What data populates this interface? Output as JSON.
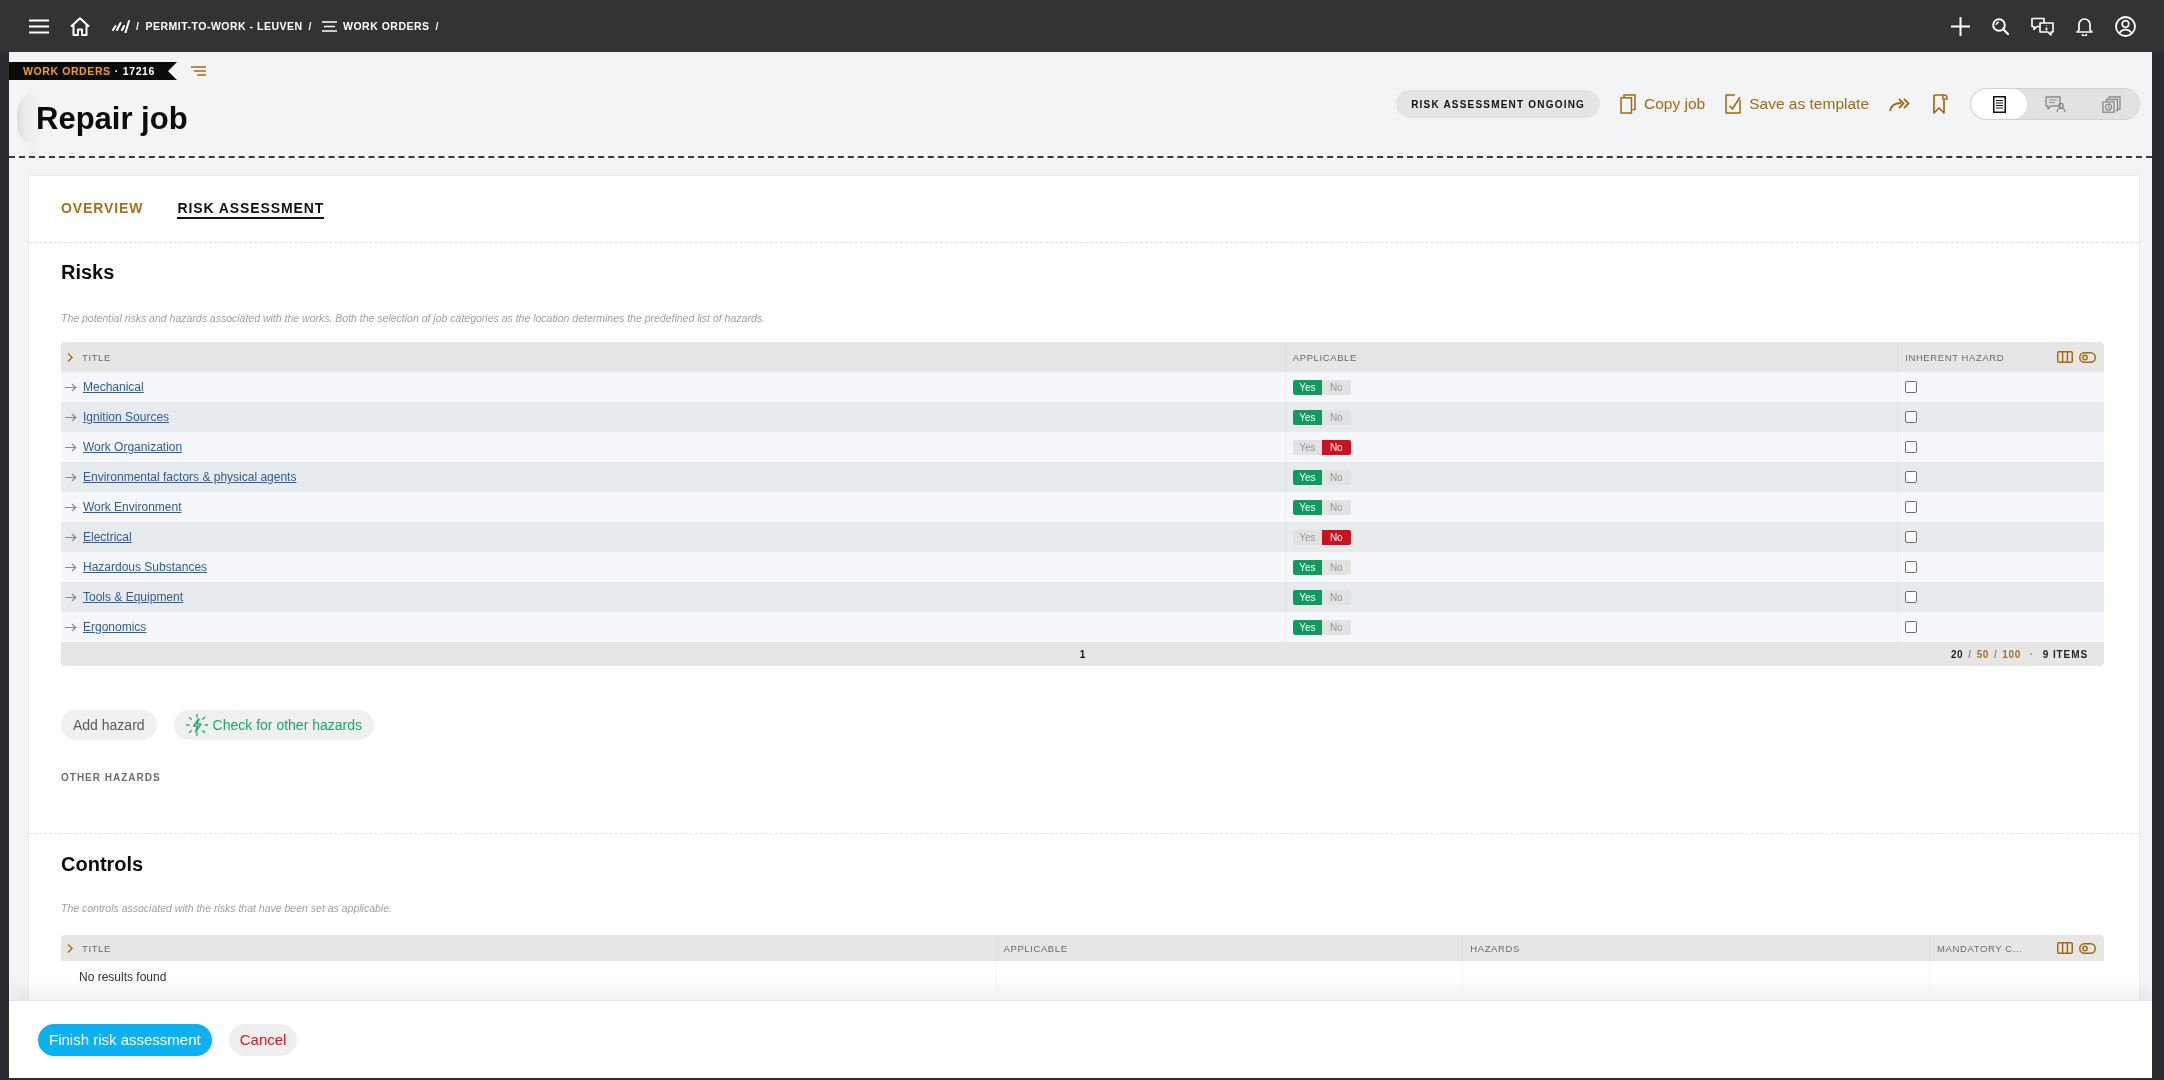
{
  "top_bar": {
    "breadcrumbs": {
      "leading_separator": "/",
      "items": [
        {
          "kind": "site",
          "label": "PERMIT-TO-WORK - LEUVEN",
          "separator": "/"
        },
        {
          "kind": "list",
          "label": "WORK ORDERS",
          "separator": "/"
        }
      ]
    }
  },
  "header": {
    "record_ribbon": {
      "module": "WORK ORDERS",
      "separator": "·",
      "number": "17216"
    },
    "title": "Repair job",
    "status": "RISK ASSESSMENT ONGOING",
    "actions": [
      {
        "kind": "copy",
        "label": "Copy job"
      },
      {
        "kind": "template",
        "label": "Save as template"
      }
    ],
    "view_switch": [
      {
        "kind": "details",
        "selected": true
      },
      {
        "kind": "comments",
        "selected": false
      },
      {
        "kind": "history",
        "selected": false
      }
    ]
  },
  "tabs": [
    {
      "label": "OVERVIEW",
      "selected": false
    },
    {
      "label": "RISK ASSESSMENT",
      "selected": true
    }
  ],
  "risks": {
    "title": "Risks",
    "description": "The potential risks and hazards associated with the works. Both the selection of job categories as the location determines the predefined list of hazards.",
    "table": {
      "columns": [
        "TITLE",
        "APPLICABLE",
        "INHERENT HAZARD"
      ],
      "rows": [
        {
          "title": "Mechanical",
          "applicable": [
            {
              "kind": "yes",
              "label": "Yes",
              "selected": true
            },
            {
              "kind": "no",
              "label": "No",
              "selected": false
            }
          ],
          "inherent_hazard_checked": false
        },
        {
          "title": "Ignition Sources",
          "applicable": [
            {
              "kind": "yes",
              "label": "Yes",
              "selected": true
            },
            {
              "kind": "no",
              "label": "No",
              "selected": false
            }
          ],
          "inherent_hazard_checked": false
        },
        {
          "title": "Work Organization",
          "applicable": [
            {
              "kind": "yes",
              "label": "Yes",
              "selected": false
            },
            {
              "kind": "no",
              "label": "No",
              "selected": true
            }
          ],
          "inherent_hazard_checked": false
        },
        {
          "title": "Environmental factors & physical agents",
          "applicable": [
            {
              "kind": "yes",
              "label": "Yes",
              "selected": true
            },
            {
              "kind": "no",
              "label": "No",
              "selected": false
            }
          ],
          "inherent_hazard_checked": false
        },
        {
          "title": "Work Environment",
          "applicable": [
            {
              "kind": "yes",
              "label": "Yes",
              "selected": true
            },
            {
              "kind": "no",
              "label": "No",
              "selected": false
            }
          ],
          "inherent_hazard_checked": false
        },
        {
          "title": "Electrical",
          "applicable": [
            {
              "kind": "yes",
              "label": "Yes",
              "selected": false
            },
            {
              "kind": "no",
              "label": "No",
              "selected": true
            }
          ],
          "inherent_hazard_checked": false
        },
        {
          "title": "Hazardous Substances",
          "applicable": [
            {
              "kind": "yes",
              "label": "Yes",
              "selected": true
            },
            {
              "kind": "no",
              "label": "No",
              "selected": false
            }
          ],
          "inherent_hazard_checked": false
        },
        {
          "title": "Tools & Equipment",
          "applicable": [
            {
              "kind": "yes",
              "label": "Yes",
              "selected": true
            },
            {
              "kind": "no",
              "label": "No",
              "selected": false
            }
          ],
          "inherent_hazard_checked": false
        },
        {
          "title": "Ergonomics",
          "applicable": [
            {
              "kind": "yes",
              "label": "Yes",
              "selected": true
            },
            {
              "kind": "no",
              "label": "No",
              "selected": false
            }
          ],
          "inherent_hazard_checked": false
        }
      ],
      "pager": {
        "pages": [
          "1"
        ],
        "page_sizes": [
          {
            "label": "20",
            "selected": true
          },
          {
            "separator": "/",
            "label": "50",
            "selected": false
          },
          {
            "separator": "/",
            "label": "100",
            "selected": false
          }
        ],
        "count_separator": "·",
        "item_count": "9 ITEMS"
      }
    },
    "buttons": [
      {
        "kind": "neutral",
        "label": "Add hazard"
      },
      {
        "kind": "ai",
        "label": "Check for other hazards"
      }
    ],
    "other_hazards_label": "OTHER HAZARDS"
  },
  "controls": {
    "title": "Controls",
    "description": "The controls associated with the risks that have been set as applicable.",
    "table": {
      "columns": [
        "TITLE",
        "APPLICABLE",
        "HAZARDS",
        "MANDATORY C..."
      ],
      "empty_message": "No results found"
    }
  },
  "action_bar": {
    "buttons": [
      {
        "kind": "primary",
        "label": "Finish risk assessment"
      },
      {
        "kind": "cancel",
        "label": "Cancel"
      }
    ]
  }
}
